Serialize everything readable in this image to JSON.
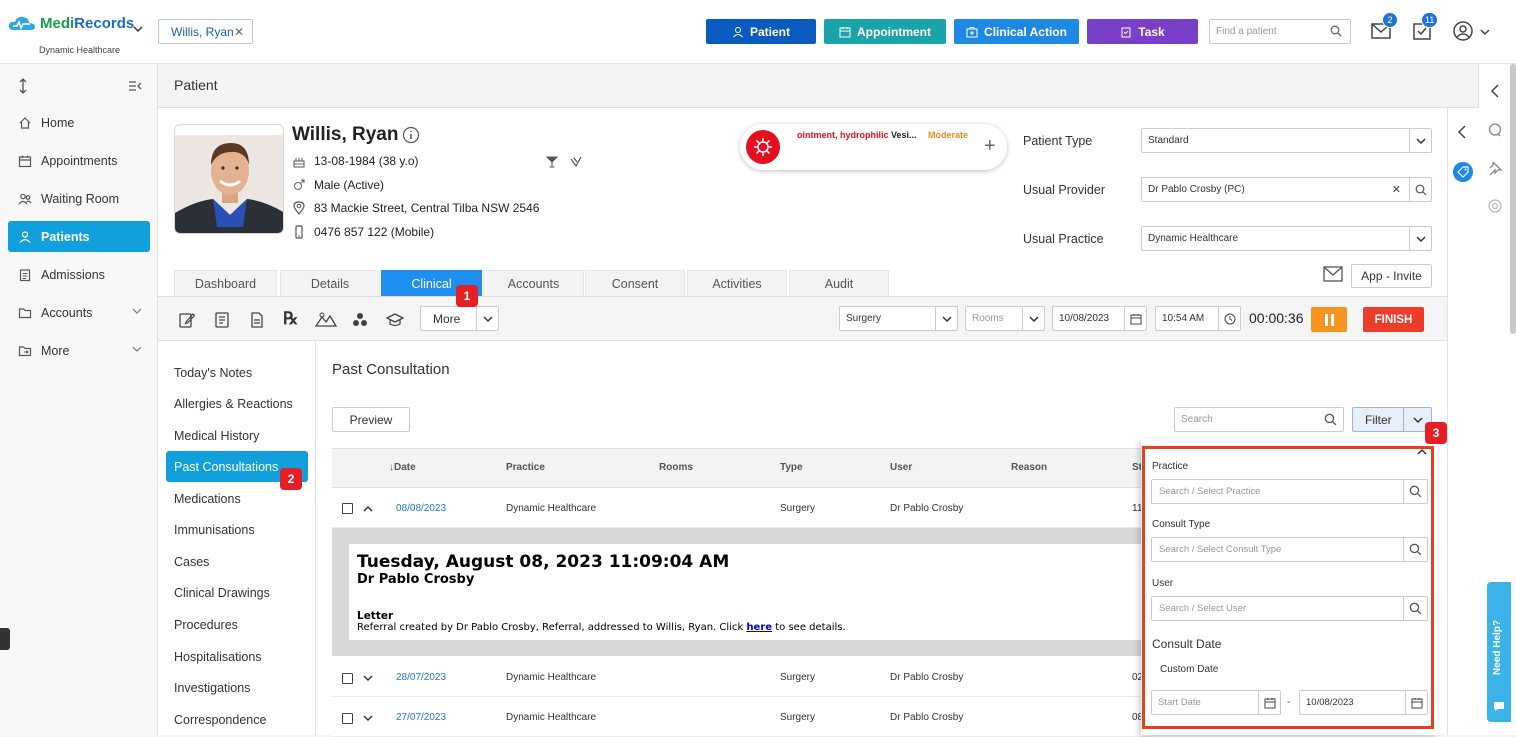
{
  "brand": {
    "name_a": "Medi",
    "name_b": "Records",
    "sub": "Dynamic Healthcare"
  },
  "header": {
    "patient_tab": "Willis, Ryan",
    "buttons": [
      {
        "label": "Patient",
        "color": "#0a5bbf"
      },
      {
        "label": "Appointment",
        "color": "#1aa3a8"
      },
      {
        "label": "Clinical Action",
        "color": "#1e88e5"
      },
      {
        "label": "Task",
        "color": "#7a3fc8"
      }
    ],
    "find_placeholder": "Find a patient",
    "mail_count": "2",
    "task_count": "11"
  },
  "sidebar": {
    "items": [
      {
        "label": "Home",
        "icon": "home-icon"
      },
      {
        "label": "Appointments",
        "icon": "calendar-icon"
      },
      {
        "label": "Waiting Room",
        "icon": "people-icon"
      },
      {
        "label": "Patients",
        "icon": "person-icon"
      },
      {
        "label": "Admissions",
        "icon": "clipboard-icon"
      },
      {
        "label": "Accounts",
        "icon": "folder-icon"
      },
      {
        "label": "More",
        "icon": "folder-arrow-icon"
      }
    ]
  },
  "page": {
    "title": "Patient"
  },
  "patient": {
    "name": "Willis, Ryan",
    "dob": "13-08-1984 (38 y.o)",
    "gender": "Male (Active)",
    "address": "83 Mackie Street, Central Tilba NSW 2546",
    "phone": "0476 857 122 (Mobile)",
    "alert_a": "ointment, hydrophilic",
    "alert_b": "Vesi...",
    "alert_severity": "Moderate"
  },
  "fields": {
    "patient_type_label": "Patient Type",
    "patient_type": "Standard",
    "usual_provider_label": "Usual Provider",
    "usual_provider": "Dr Pablo Crosby (PC)",
    "usual_practice_label": "Usual Practice",
    "usual_practice": "Dynamic Healthcare"
  },
  "tabs": [
    "Dashboard",
    "Details",
    "Clinical",
    "Accounts",
    "Consent",
    "Activities",
    "Audit"
  ],
  "invite_label": "App - Invite",
  "toolbar": {
    "more": "More",
    "location": "Surgery",
    "rooms": "Rooms",
    "date": "10/08/2023",
    "time": "10:54 AM",
    "timer": "00:00:36",
    "finish": "FINISH"
  },
  "subnav": [
    "Today's Notes",
    "Allergies & Reactions",
    "Medical History",
    "Past Consultations",
    "Medications",
    "Immunisations",
    "Cases",
    "Clinical Drawings",
    "Procedures",
    "Hospitalisations",
    "Investigations",
    "Correspondence"
  ],
  "content": {
    "title": "Past Consultation",
    "preview": "Preview",
    "search_placeholder": "Search",
    "filter": "Filter",
    "columns": [
      "↓Date",
      "Practice",
      "Rooms",
      "Type",
      "User",
      "Reason",
      "St"
    ],
    "rows": [
      {
        "date": "08/08/2023",
        "practice": "Dynamic Healthcare",
        "type": "Surgery",
        "user": "Dr Pablo Crosby",
        "st": "11"
      },
      {
        "date": "28/07/2023",
        "practice": "Dynamic Healthcare",
        "type": "Surgery",
        "user": "Dr Pablo Crosby",
        "st": "02"
      },
      {
        "date": "27/07/2023",
        "practice": "Dynamic Healthcare",
        "type": "Surgery",
        "user": "Dr Pablo Crosby",
        "st": "08"
      }
    ],
    "detail": {
      "datetime": "Tuesday, August 08, 2023 11:09:04 AM",
      "doctor": "Dr Pablo Crosby",
      "kind": "Letter",
      "text_before": "Referral created by Dr Pablo Crosby, Referral, addressed to Willis, Ryan. Click ",
      "link": "here",
      "text_after": " to see details."
    }
  },
  "filter_panel": {
    "practice_label": "Practice",
    "practice_ph": "Search / Select Practice",
    "consult_type_label": "Consult Type",
    "consult_type_ph": "Search / Select Consult Type",
    "user_label": "User",
    "user_ph": "Search / Select User",
    "consult_date_label": "Consult Date",
    "custom_date_label": "Custom Date",
    "start_ph": "Start Date",
    "dash": "-",
    "end_date": "10/08/2023"
  },
  "annotations": [
    "1",
    "2",
    "3"
  ],
  "help_label": "Need Help?"
}
